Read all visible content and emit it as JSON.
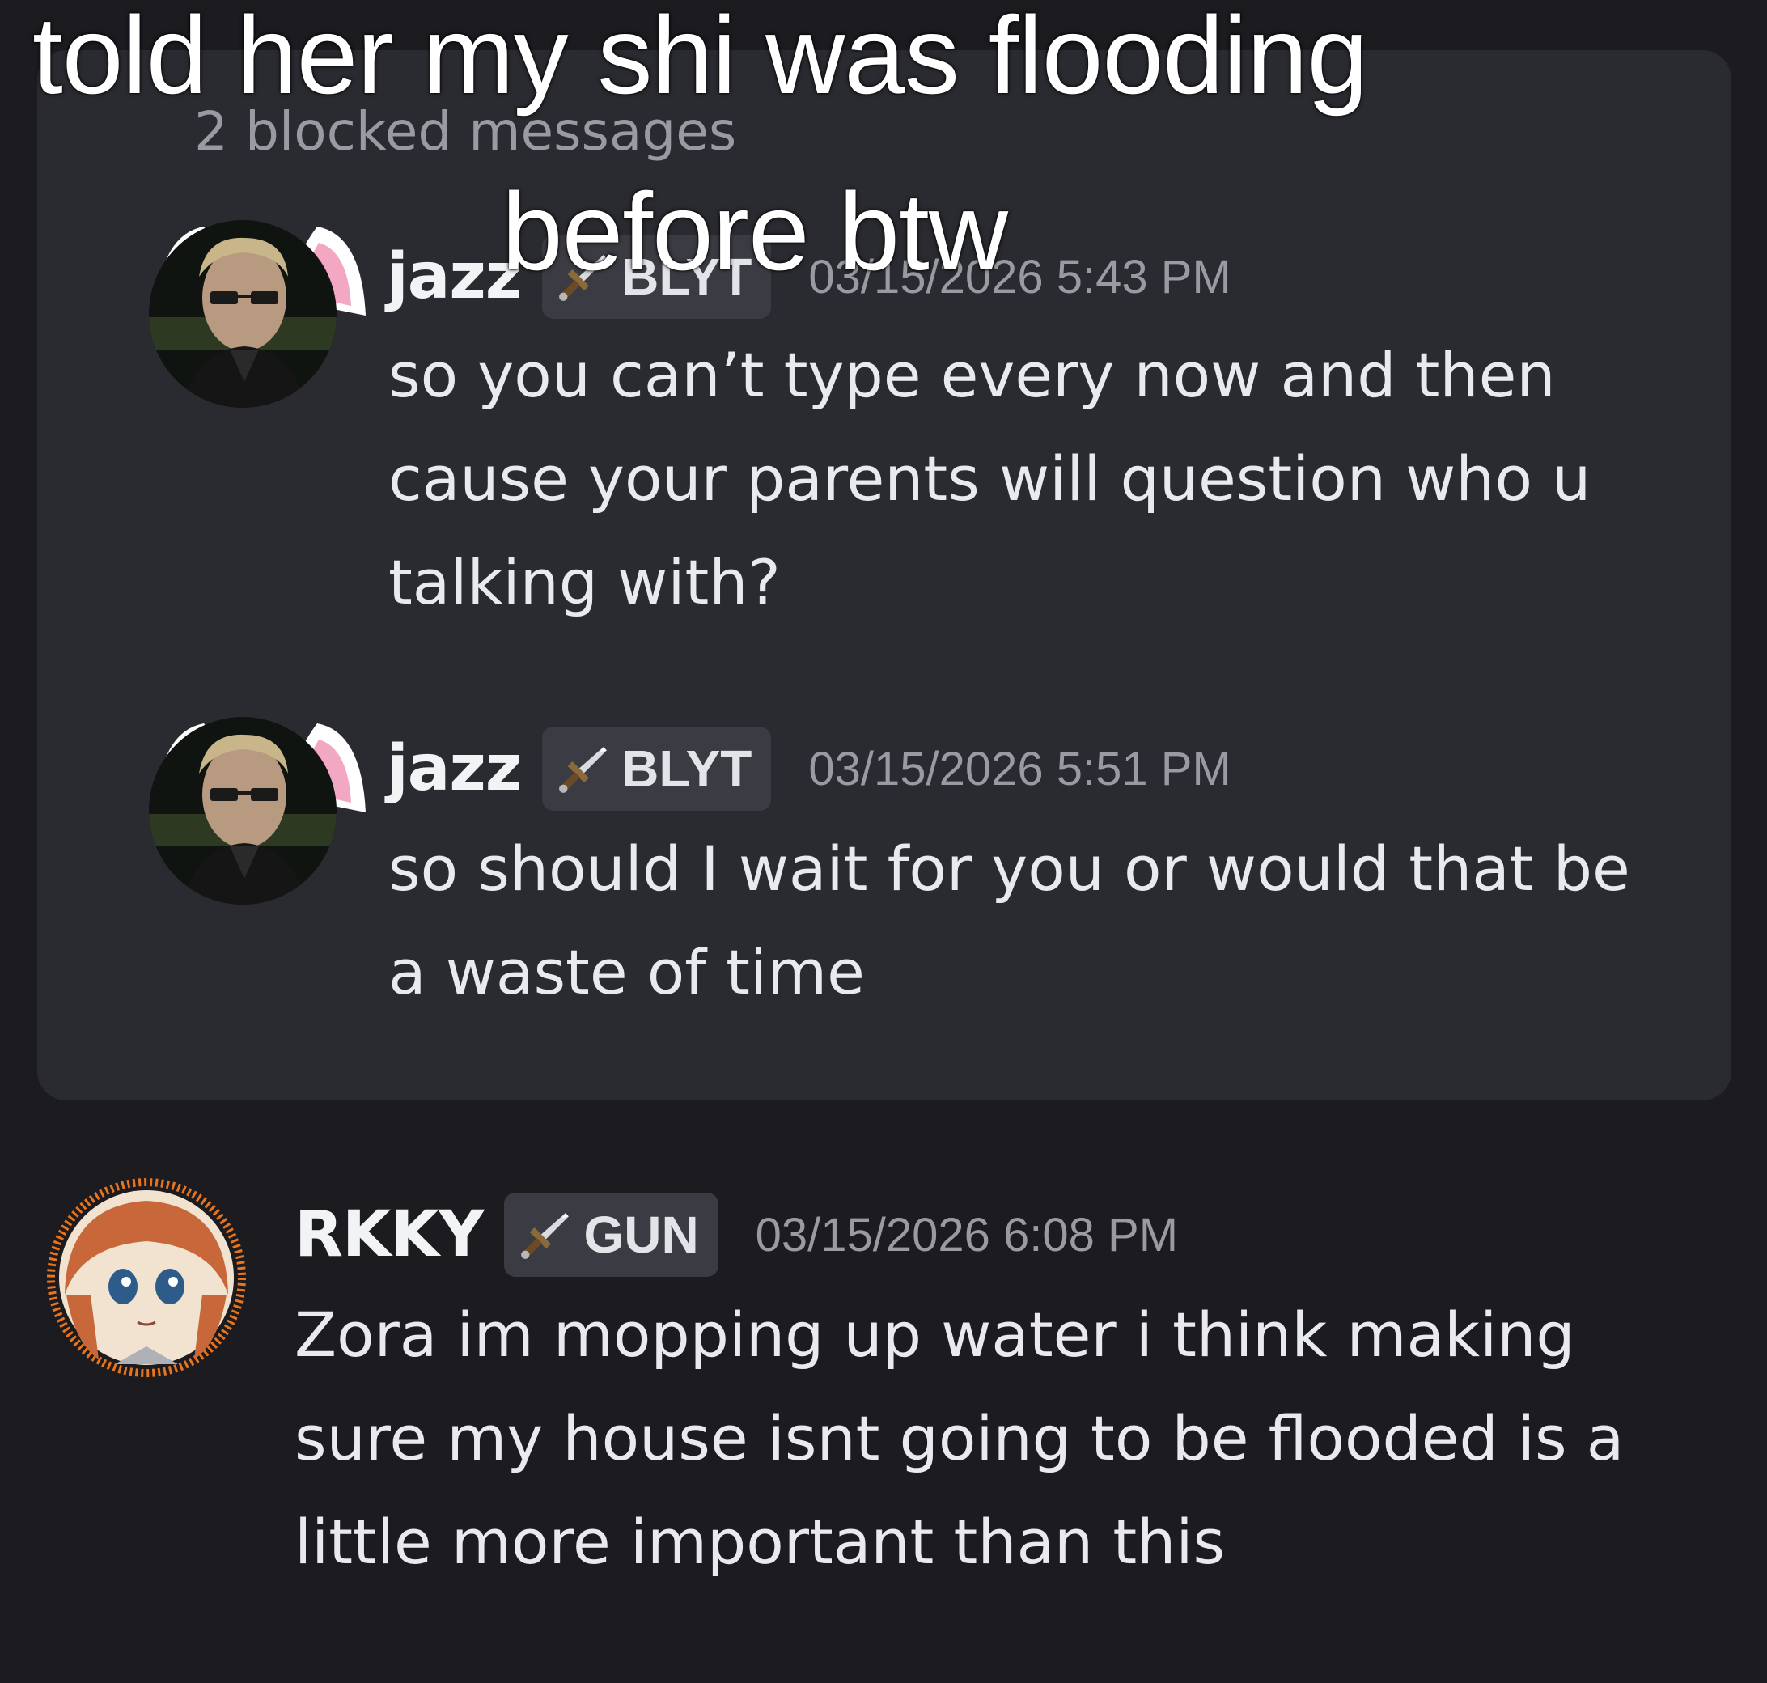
{
  "caption": {
    "line1": "told her my shi was flooding",
    "line2": "before btw"
  },
  "blocked": {
    "label": "2 blocked messages",
    "messages": [
      {
        "author": "jazz",
        "tag": "BLYT",
        "timestamp": "03/15/2026 5:43 PM",
        "text": "so you can’t type every now and then cause your parents will question who u talking with?"
      },
      {
        "author": "jazz",
        "tag": "BLYT",
        "timestamp": "03/15/2026 5:51 PM",
        "text": "so should I wait for you or would that be a waste of time"
      }
    ]
  },
  "message": {
    "author": "RKKY",
    "tag": "GUN",
    "timestamp": "03/15/2026 6:08 PM",
    "text": "Zora im mopping up water i think making sure my house isnt going to be flooded is a little more important than this"
  },
  "icons": {
    "tag_icon": "sword-icon",
    "avatar_decoration": "cat-ears"
  },
  "colors": {
    "background": "#1b1b20",
    "blocked_panel": "#2a2b30",
    "tag_background": "#3b3c43",
    "muted_text": "#9a9ba2",
    "avatar_ring": "#e8741c"
  }
}
